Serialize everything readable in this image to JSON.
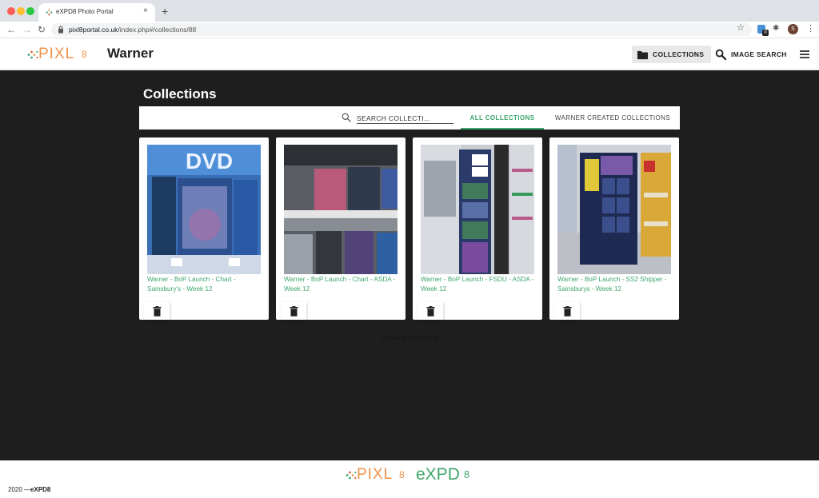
{
  "browser": {
    "tab_title": "eXPD8 Photo Portal",
    "tab_close": "×",
    "new_tab": "+",
    "url_host": "pixl8portal.co.uk",
    "url_path": "/index.php#/collections/88",
    "profile_initial": "S",
    "extension_badge": "0"
  },
  "header": {
    "logo_text": "PIXL",
    "logo_suffix": "8",
    "brand": "Warner",
    "collections_label": "COLLECTIONS",
    "image_search_label": "IMAGE SEARCH"
  },
  "main": {
    "title": "Collections",
    "search_placeholder": "SEARCH COLLECTI...",
    "tabs": [
      {
        "label": "ALL COLLECTIONS",
        "active": true
      },
      {
        "label": "WARNER CREATED COLLECTIONS",
        "active": false
      }
    ],
    "collections": [
      {
        "title": "Warner - BoP Launch - Chart - Sainsbury's - Week 12"
      },
      {
        "title": "Warner - BoP Launch - Chart - ASDA - Week 12"
      },
      {
        "title": "Warner - BoP Launch - FSDU - ASDA - Week 12"
      },
      {
        "title": "Warner - BoP Launch - SS2 Shipper - Sainsburys - Week 12"
      }
    ],
    "no_more_text": "No more collections"
  },
  "footer": {
    "pixl_text": "PIXL",
    "pixl_suffix": "8",
    "expd_text": "eXPD",
    "expd_suffix": "8",
    "copyright_year": "2020 —",
    "copyright_brand": "eXPD8"
  },
  "colors": {
    "accent_green": "#3fa66c",
    "logo_orange": "#f0924a",
    "page_background": "#1e1e1e"
  }
}
